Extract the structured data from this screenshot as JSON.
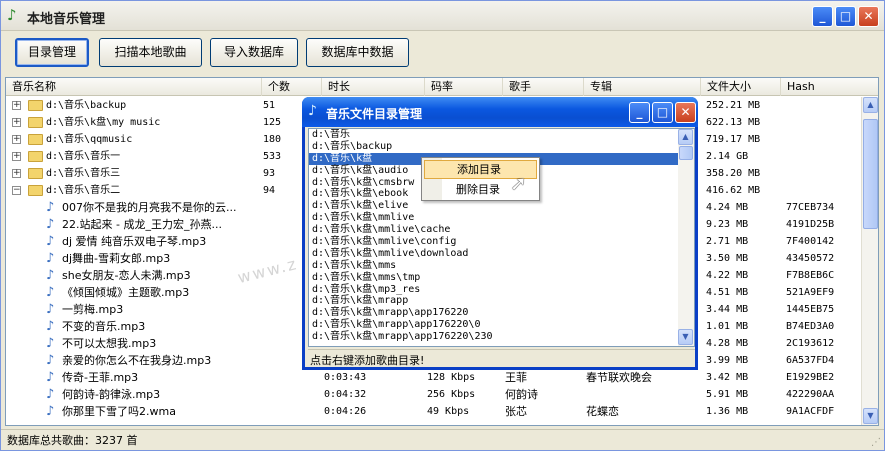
{
  "window": {
    "title": "本地音乐管理"
  },
  "toolbar": {
    "buttons": [
      "目录管理",
      "扫描本地歌曲",
      "导入数据库",
      "数据库中数据"
    ]
  },
  "columns": [
    "音乐名称",
    "个数",
    "时长",
    "码率",
    "歌手",
    "专辑",
    "文件大小",
    "Hash"
  ],
  "folders": [
    {
      "name": "d:\\音乐\\backup",
      "count": "51",
      "size": "252.21 MB"
    },
    {
      "name": "d:\\音乐\\k盘\\my music",
      "count": "125",
      "size": "622.13 MB"
    },
    {
      "name": "d:\\音乐\\qqmusic",
      "count": "180",
      "size": "719.17 MB"
    },
    {
      "name": "d:\\音乐\\音乐一",
      "count": "533",
      "size": "2.14 GB"
    },
    {
      "name": "d:\\音乐\\音乐三",
      "count": "93",
      "size": "358.20 MB"
    },
    {
      "name": "d:\\音乐\\音乐二",
      "count": "94",
      "size": "416.62 MB"
    }
  ],
  "songs": [
    {
      "name": "007你不是我的月亮我不是你的云...",
      "duration": "",
      "bitrate": "",
      "artist": "",
      "album": "",
      "size": "4.24 MB",
      "hash": "77CEB734"
    },
    {
      "name": "22.站起来 - 成龙_王力宏_孙燕...",
      "duration": "",
      "bitrate": "",
      "artist": "",
      "album": "",
      "size": "9.23 MB",
      "hash": "4191D25B"
    },
    {
      "name": "dj 爱情 纯音乐双电子琴.mp3",
      "duration": "",
      "bitrate": "",
      "artist": "",
      "album": "",
      "size": "2.71 MB",
      "hash": "7F400142"
    },
    {
      "name": "dj舞曲-雪莉女郎.mp3",
      "duration": "",
      "bitrate": "",
      "artist": "",
      "album": "",
      "size": "3.50 MB",
      "hash": "43450572"
    },
    {
      "name": "she女朋友-恋人未满.mp3",
      "duration": "",
      "bitrate": "",
      "artist": "",
      "album": "",
      "size": "4.22 MB",
      "hash": "F7B8EB6C"
    },
    {
      "name": "《倾国倾城》主题歌.mp3",
      "duration": "",
      "bitrate": "",
      "artist": "",
      "album": "",
      "size": "4.51 MB",
      "hash": "521A9EF9"
    },
    {
      "name": "一剪梅.mp3",
      "duration": "",
      "bitrate": "",
      "artist": "",
      "album": "",
      "size": "3.44 MB",
      "hash": "1445EB75"
    },
    {
      "name": "不变的音乐.mp3",
      "duration": "",
      "bitrate": "",
      "artist": "",
      "album": "",
      "size": "1.01 MB",
      "hash": "B74ED3A0"
    },
    {
      "name": "不可以太想我.mp3",
      "duration": "",
      "bitrate": "",
      "artist": "",
      "album": "",
      "size": "4.28 MB",
      "hash": "2C193612"
    },
    {
      "name": "亲爱的你怎么不在我身边.mp3",
      "duration": "",
      "bitrate": "",
      "artist": "",
      "album": "",
      "size": "3.99 MB",
      "hash": "6A537FD4"
    },
    {
      "name": "传奇-王菲.mp3",
      "duration": "0:03:43",
      "bitrate": "128 Kbps",
      "artist": "王菲",
      "album": "春节联欢晚会",
      "size": "3.42 MB",
      "hash": "E1929BE2"
    },
    {
      "name": "何韵诗-韵律泳.mp3",
      "duration": "0:04:32",
      "bitrate": "256 Kbps",
      "artist": "何韵诗",
      "album": "",
      "size": "5.91 MB",
      "hash": "422290AA"
    },
    {
      "name": "你那里下雪了吗2.wma",
      "duration": "0:04:26",
      "bitrate": "49 Kbps",
      "artist": "张芯",
      "album": "花蝶恋",
      "size": "1.36 MB",
      "hash": "9A1ACFDF"
    }
  ],
  "status": {
    "text": "数据库总共歌曲：3237 首"
  },
  "dialog": {
    "title": "音乐文件目录管理",
    "status": "点击右键添加歌曲目录!",
    "dirs": [
      "d:\\音乐",
      "d:\\音乐\\backup",
      "d:\\音乐\\k盘",
      "d:\\音乐\\k盘\\audio",
      "d:\\音乐\\k盘\\cmsbrw",
      "d:\\音乐\\k盘\\ebook",
      "d:\\音乐\\k盘\\elive",
      "d:\\音乐\\k盘\\mmlive",
      "d:\\音乐\\k盘\\mmlive\\cache",
      "d:\\音乐\\k盘\\mmlive\\config",
      "d:\\音乐\\k盘\\mmlive\\download",
      "d:\\音乐\\k盘\\mms",
      "d:\\音乐\\k盘\\mms\\tmp",
      "d:\\音乐\\k盘\\mp3_res",
      "d:\\音乐\\k盘\\mrapp",
      "d:\\音乐\\k盘\\mrapp\\app176220",
      "d:\\音乐\\k盘\\mrapp\\app176220\\0",
      "d:\\音乐\\k盘\\mrapp\\app176220\\230"
    ],
    "selected_index": 2
  },
  "context_menu": {
    "items": [
      "添加目录",
      "删除目录"
    ],
    "hover_index": 0
  },
  "watermark": "www.z"
}
